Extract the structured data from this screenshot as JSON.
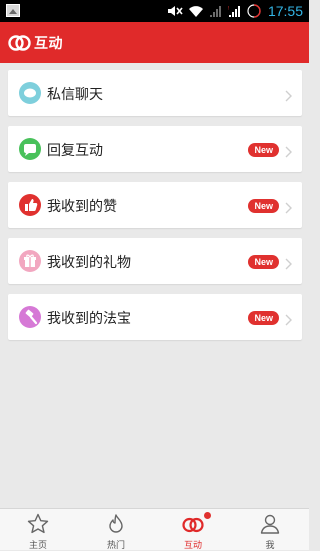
{
  "status_bar": {
    "time": "17:55",
    "icons": [
      "gallery-thumbnail-icon",
      "mute-icon",
      "wifi-icon",
      "signal-icon",
      "signal-icon",
      "battery-icon"
    ]
  },
  "header": {
    "title": "互动",
    "logo_icon": "interaction-rings-icon",
    "bg_color": "#e02a2a"
  },
  "list": {
    "items": [
      {
        "label": "私信聊天",
        "icon": "chat-bubble-icon",
        "icon_color": "#7ecfdc",
        "badge": ""
      },
      {
        "label": "回复互动",
        "icon": "reply-bubble-icon",
        "icon_color": "#49c15b",
        "badge": "New"
      },
      {
        "label": "我收到的赞",
        "icon": "thumbs-up-icon",
        "icon_color": "#e0312f",
        "badge": "New"
      },
      {
        "label": "我收到的礼物",
        "icon": "gift-icon",
        "icon_color": "#f2a7c0",
        "badge": "New"
      },
      {
        "label": "我收到的法宝",
        "icon": "magic-hammer-icon",
        "icon_color": "#d679d6",
        "badge": "New"
      }
    ]
  },
  "tab_bar": {
    "tabs": [
      {
        "label": "主页",
        "icon": "star-icon",
        "active": false
      },
      {
        "label": "热门",
        "icon": "flame-icon",
        "active": false
      },
      {
        "label": "互动",
        "icon": "interaction-rings-icon",
        "active": true
      },
      {
        "label": "我",
        "icon": "person-icon",
        "active": false
      }
    ]
  }
}
